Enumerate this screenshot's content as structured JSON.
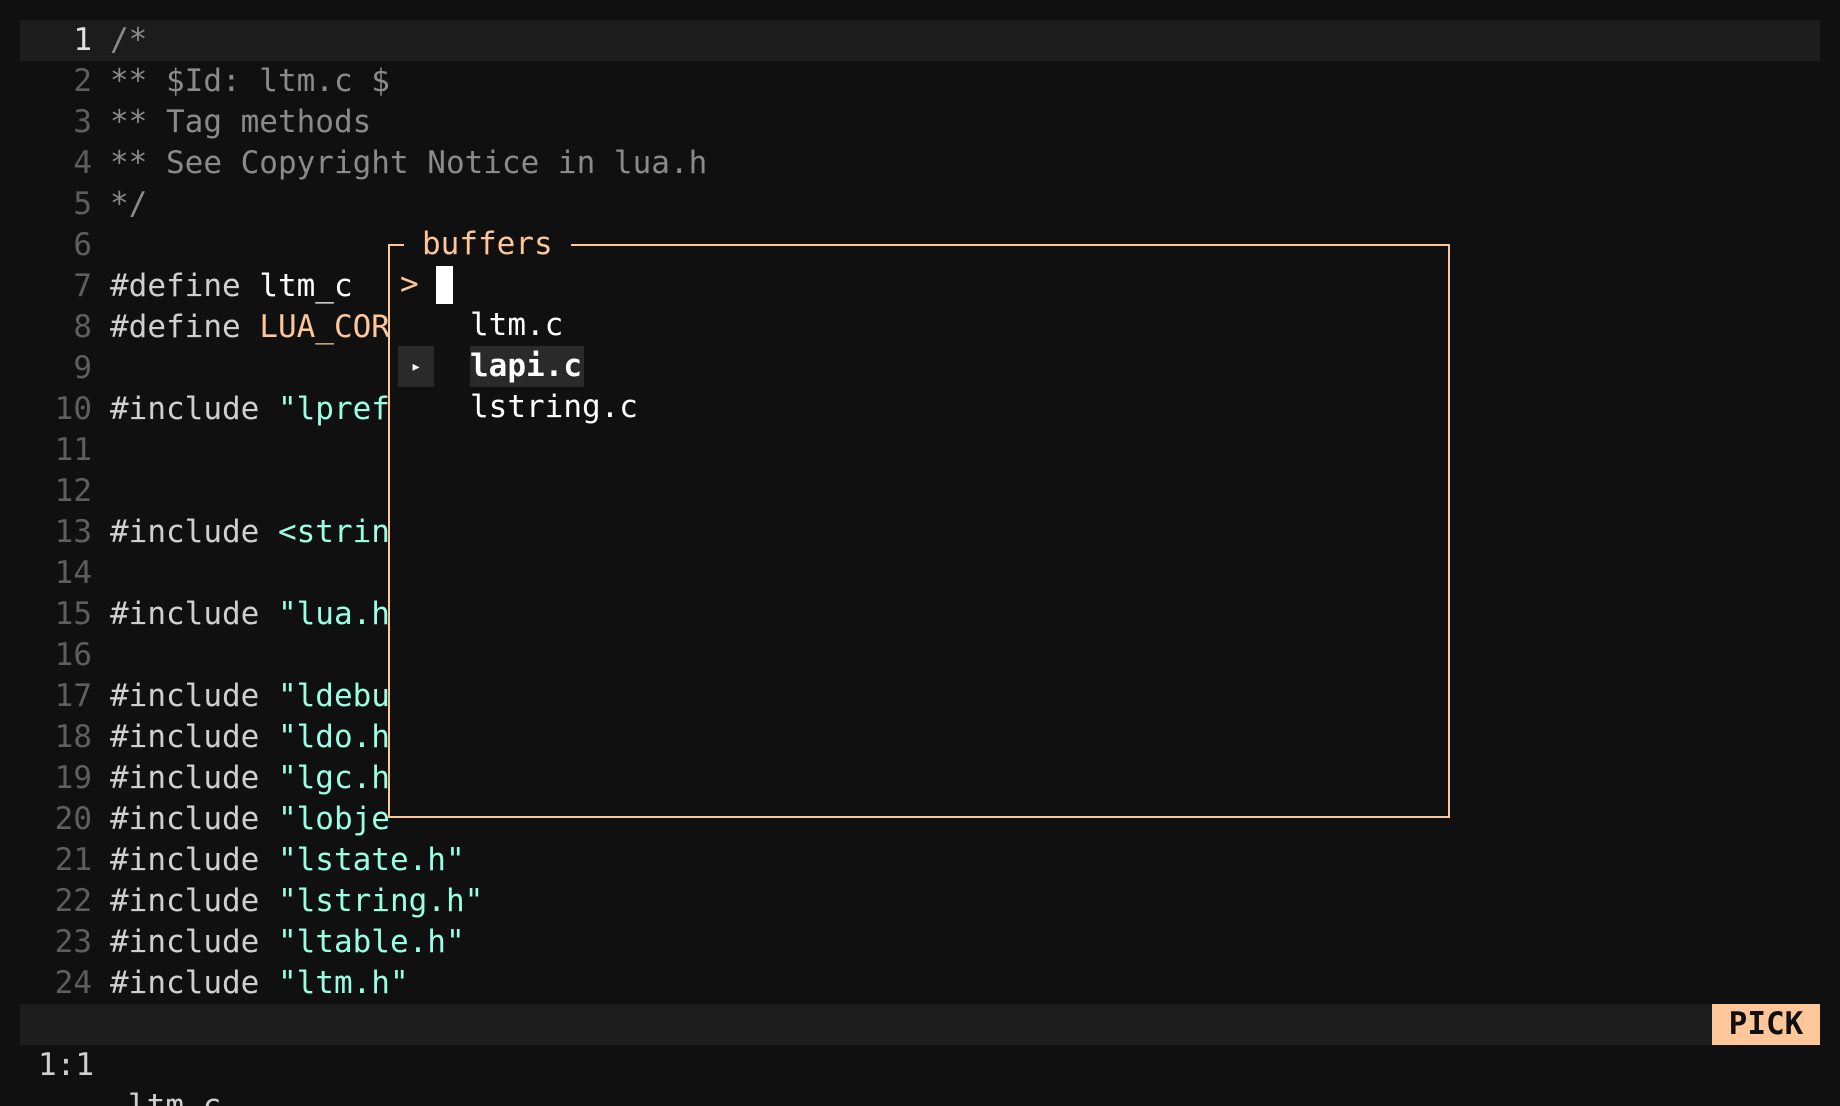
{
  "editor": {
    "lines": [
      {
        "n": "1",
        "parts": [
          {
            "t": "/*",
            "c": "comment"
          }
        ]
      },
      {
        "n": "2",
        "parts": [
          {
            "t": "** $Id: ltm.c $",
            "c": "comment"
          }
        ]
      },
      {
        "n": "3",
        "parts": [
          {
            "t": "** Tag methods",
            "c": "comment"
          }
        ]
      },
      {
        "n": "4",
        "parts": [
          {
            "t": "** See Copyright Notice in lua.h",
            "c": "comment"
          }
        ]
      },
      {
        "n": "5",
        "parts": [
          {
            "t": "*/",
            "c": "comment"
          }
        ]
      },
      {
        "n": "6",
        "parts": []
      },
      {
        "n": "7",
        "parts": [
          {
            "t": "#define ",
            "c": "kw"
          },
          {
            "t": "ltm_c",
            "c": "ident"
          }
        ]
      },
      {
        "n": "8",
        "parts": [
          {
            "t": "#define ",
            "c": "kw"
          },
          {
            "t": "LUA_COR",
            "c": "macro"
          }
        ]
      },
      {
        "n": "9",
        "parts": []
      },
      {
        "n": "10",
        "parts": [
          {
            "t": "#include ",
            "c": "kw"
          },
          {
            "t": "\"lpref",
            "c": "str"
          }
        ]
      },
      {
        "n": "11",
        "parts": []
      },
      {
        "n": "12",
        "parts": []
      },
      {
        "n": "13",
        "parts": [
          {
            "t": "#include ",
            "c": "kw"
          },
          {
            "t": "<strin",
            "c": "str"
          }
        ]
      },
      {
        "n": "14",
        "parts": []
      },
      {
        "n": "15",
        "parts": [
          {
            "t": "#include ",
            "c": "kw"
          },
          {
            "t": "\"lua.h",
            "c": "str"
          }
        ]
      },
      {
        "n": "16",
        "parts": []
      },
      {
        "n": "17",
        "parts": [
          {
            "t": "#include ",
            "c": "kw"
          },
          {
            "t": "\"ldebu",
            "c": "str"
          }
        ]
      },
      {
        "n": "18",
        "parts": [
          {
            "t": "#include ",
            "c": "kw"
          },
          {
            "t": "\"ldo.h",
            "c": "str"
          }
        ]
      },
      {
        "n": "19",
        "parts": [
          {
            "t": "#include ",
            "c": "kw"
          },
          {
            "t": "\"lgc.h",
            "c": "str"
          }
        ]
      },
      {
        "n": "20",
        "parts": [
          {
            "t": "#include ",
            "c": "kw"
          },
          {
            "t": "\"lobje",
            "c": "str"
          }
        ]
      },
      {
        "n": "21",
        "parts": [
          {
            "t": "#include ",
            "c": "kw"
          },
          {
            "t": "\"lstate.h\"",
            "c": "str"
          }
        ]
      },
      {
        "n": "22",
        "parts": [
          {
            "t": "#include ",
            "c": "kw"
          },
          {
            "t": "\"lstring.h\"",
            "c": "str"
          }
        ]
      },
      {
        "n": "23",
        "parts": [
          {
            "t": "#include ",
            "c": "kw"
          },
          {
            "t": "\"ltable.h\"",
            "c": "str"
          }
        ]
      },
      {
        "n": "24",
        "parts": [
          {
            "t": "#include ",
            "c": "kw"
          },
          {
            "t": "\"ltm.h\"",
            "c": "str"
          }
        ]
      }
    ]
  },
  "picker": {
    "title": "buffers",
    "prompt_symbol": ">",
    "query": "",
    "items": [
      {
        "label": "ltm.c",
        "selected": false
      },
      {
        "label": "lapi.c",
        "selected": true
      },
      {
        "label": "lstring.c",
        "selected": false
      }
    ],
    "selected_marker": "▸"
  },
  "statusbar": {
    "position": "1:1",
    "filename": "ltm.c",
    "mode": "PICK"
  },
  "colors": {
    "background": "#101010",
    "accent": "#ffc799",
    "string": "#99ffe4",
    "comment": "#8a8a8a"
  }
}
